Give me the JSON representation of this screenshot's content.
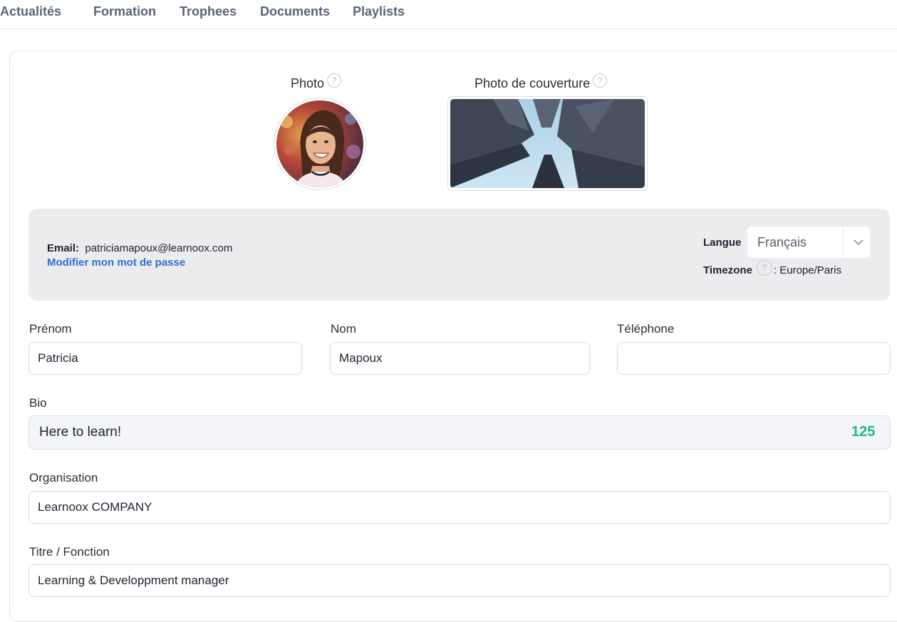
{
  "tabs": [
    {
      "label": "Actualités"
    },
    {
      "label": "Formation"
    },
    {
      "label": "Trophees"
    },
    {
      "label": "Documents"
    },
    {
      "label": "Playlists"
    }
  ],
  "uploads": {
    "photo_label": "Photo",
    "cover_label": "Photo de couverture",
    "help_glyph": "?"
  },
  "account": {
    "email_label": "Email:",
    "email_value": "patriciamapoux@learnoox.com",
    "change_password": "Modifier mon mot de passe",
    "language_label": "Langue",
    "language_value": "Français",
    "timezone_label": "Timezone",
    "timezone_value": ": Europe/Paris"
  },
  "form": {
    "first_name": {
      "label": "Prénom",
      "value": "Patricia"
    },
    "last_name": {
      "label": "Nom",
      "value": "Mapoux"
    },
    "phone": {
      "label": "Téléphone",
      "value": ""
    },
    "bio": {
      "label": "Bio",
      "value": "Here to learn!",
      "counter": "125"
    },
    "organisation": {
      "label": "Organisation",
      "value": "Learnoox COMPANY"
    },
    "title": {
      "label": "Titre / Fonction",
      "value": "Learning & Developpment manager"
    }
  },
  "colors": {
    "tab_text": "#5b6478",
    "link": "#2c6fd6",
    "counter": "#22b48a",
    "panel_bg": "#ececee"
  }
}
